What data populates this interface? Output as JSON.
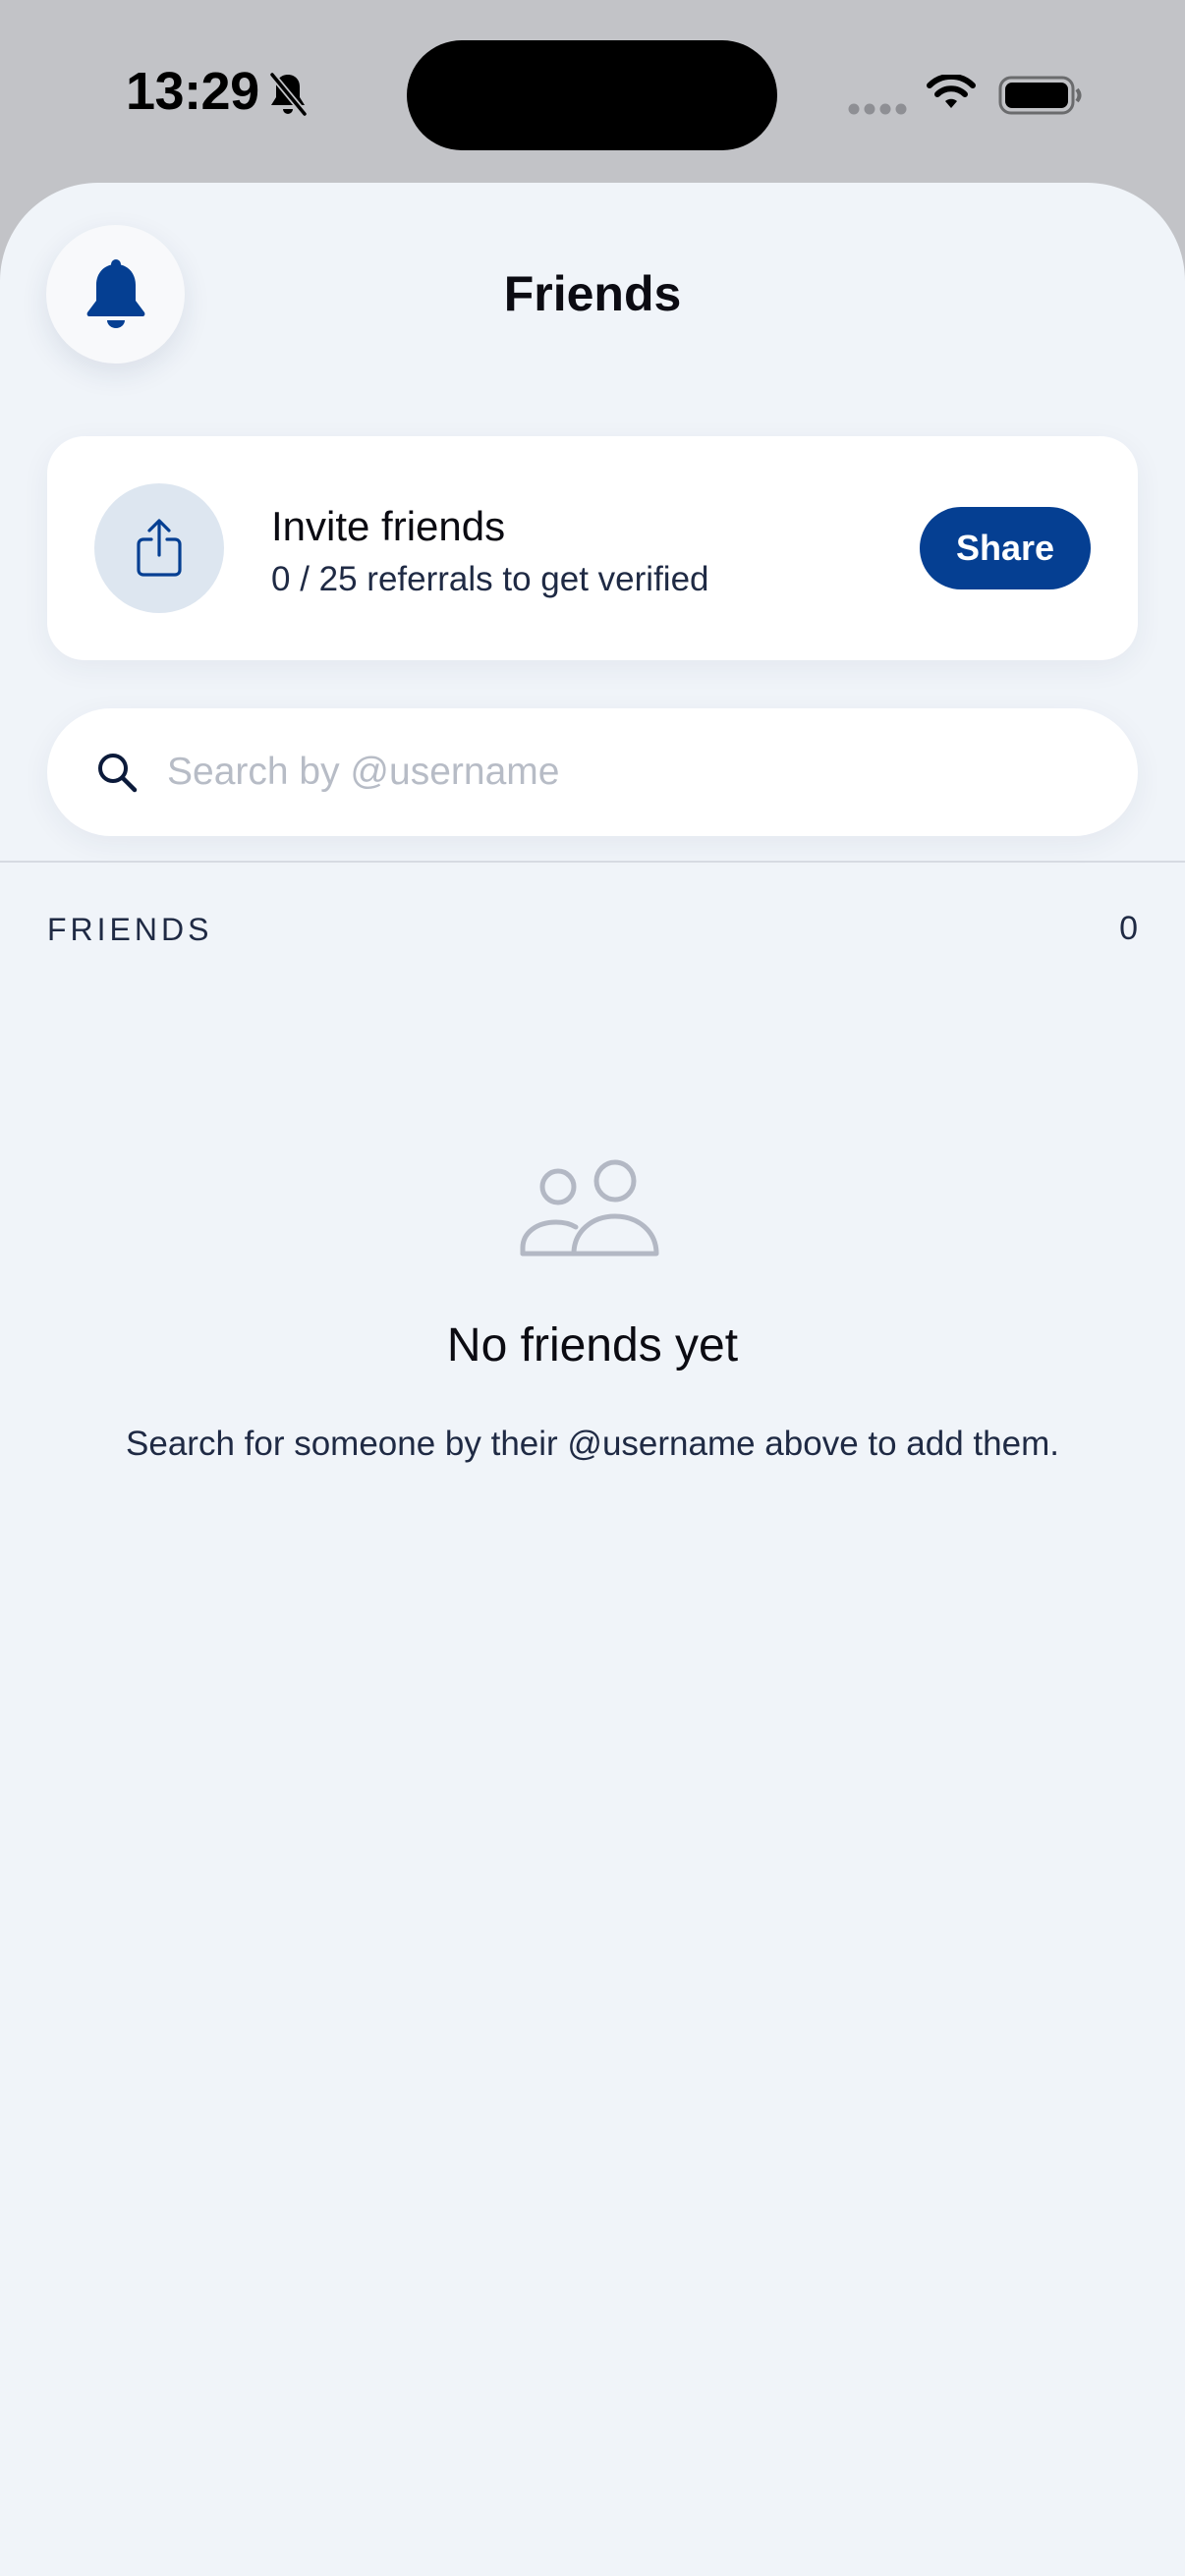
{
  "status_bar": {
    "time": "13:29",
    "icons": [
      "bell-slash-icon",
      "cellular-icon",
      "wifi-icon",
      "battery-icon"
    ]
  },
  "header": {
    "title": "Friends",
    "left_icon": "bell-icon"
  },
  "invite_card": {
    "icon": "share-icon",
    "title": "Invite friends",
    "subtitle": "0 / 25 referrals to get verified",
    "button_label": "Share"
  },
  "search": {
    "icon": "search-icon",
    "placeholder": "Search by @username",
    "value": ""
  },
  "friends_section": {
    "label": "FRIENDS",
    "count": "0"
  },
  "empty_state": {
    "icon": "people-icon",
    "title": "No friends yet",
    "text": "Search for someone by their @username above to add them."
  },
  "colors": {
    "accent": "#053f92",
    "background": "#f0f4f9",
    "card": "#ffffff",
    "muted_icon": "#b3b8c4"
  }
}
